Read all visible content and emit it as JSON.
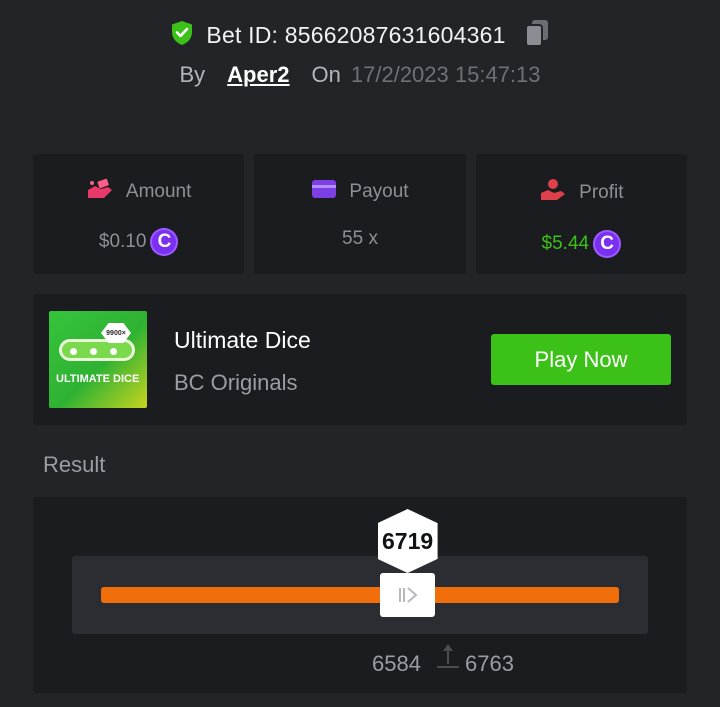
{
  "header": {
    "bet_id_label": "Bet ID: 85662087631604361",
    "by_label": "By",
    "username": "Aper2",
    "on_label": "On",
    "timestamp": "17/2/2023 15:47:13"
  },
  "stats": [
    {
      "label": "Amount",
      "value": "$0.10",
      "currency_icon": "C",
      "icon": "money-hand-icon"
    },
    {
      "label": "Payout",
      "value": "55 x",
      "icon": "card-icon"
    },
    {
      "label": "Profit",
      "value": "$5.44",
      "currency_icon": "C",
      "icon": "profit-hand-icon"
    }
  ],
  "game": {
    "thumbnail_tag": "9900×",
    "thumbnail_title": "ULTIMATE DICE",
    "name": "Ultimate Dice",
    "provider": "BC Originals",
    "play_label": "Play Now"
  },
  "result": {
    "label": "Result",
    "value": "6719",
    "range_low": "6584",
    "range_high": "6763",
    "slider_fraction": 0.5919
  },
  "colors": {
    "background": "#232428",
    "card": "#1b1c1f",
    "accent_green": "#3bc117",
    "accent_orange": "#f06e0c",
    "coin_purple": "#7b2ff0",
    "stat_icon_pink": "#e83a6a",
    "stat_icon_purple": "#7b3fe4",
    "stat_icon_red": "#e0404a"
  }
}
